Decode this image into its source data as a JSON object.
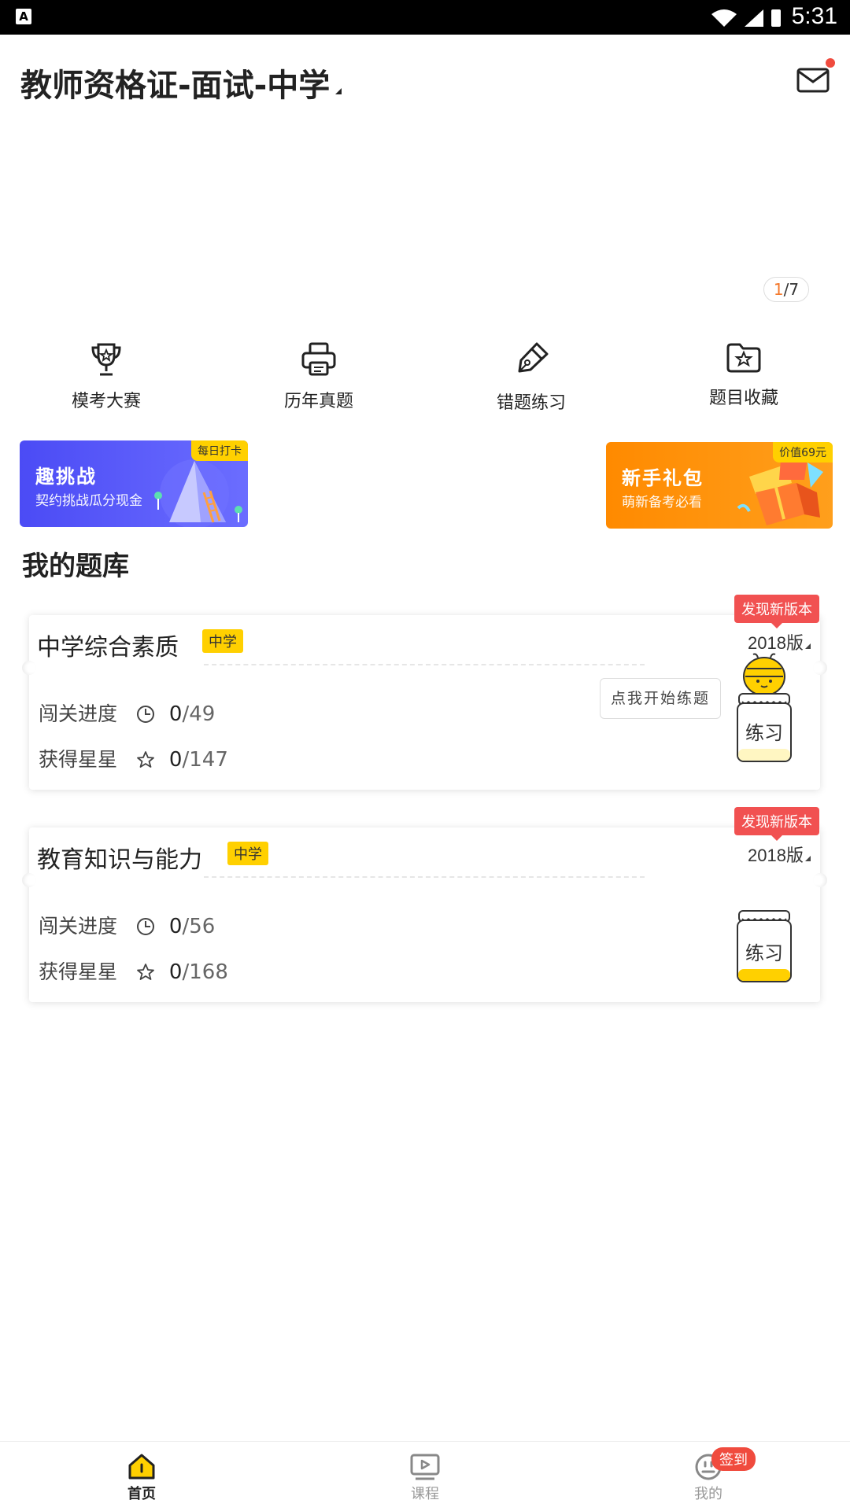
{
  "status_bar": {
    "time": "5:31",
    "left_icon": "A"
  },
  "header": {
    "title": "教师资格证-面试-中学",
    "mail_icon": "mail-icon",
    "has_notification": true
  },
  "carousel": {
    "current": "1",
    "total": "/7"
  },
  "quick_menu": [
    {
      "label": "模考大赛",
      "icon": "trophy-icon"
    },
    {
      "label": "历年真题",
      "icon": "printer-icon"
    },
    {
      "label": "错题练习",
      "icon": "pen-icon"
    },
    {
      "label": "题目收藏",
      "icon": "folder-star-icon"
    }
  ],
  "promos": [
    {
      "title": "趣挑战",
      "subtitle": "契约挑战瓜分现金",
      "tag": "每日打卡",
      "color": "#4b4bf5"
    },
    {
      "title": "新手礼包",
      "subtitle": "萌新备考必看",
      "tag": "价值69元",
      "color": "#ff8a00"
    }
  ],
  "bank": {
    "title": "我的题库",
    "tip": "点我开始练题",
    "items": [
      {
        "name": "中学综合素质",
        "level": "中学",
        "version": "2018版",
        "new_badge": "发现新版本",
        "progress_label": "闯关进度",
        "progress_done": "0",
        "progress_total": "/49",
        "stars_label": "获得星星",
        "stars_done": "0",
        "stars_total": "/147",
        "button": "练习"
      },
      {
        "name": "教育知识与能力",
        "level": "中学",
        "version": "2018版",
        "new_badge": "发现新版本",
        "progress_label": "闯关进度",
        "progress_done": "0",
        "progress_total": "/56",
        "stars_label": "获得星星",
        "stars_done": "0",
        "stars_total": "/168",
        "button": "练习"
      }
    ]
  },
  "bottom_nav": [
    {
      "label": "首页",
      "icon": "home-icon",
      "active": true
    },
    {
      "label": "课程",
      "icon": "play-icon",
      "active": false
    },
    {
      "label": "我的",
      "icon": "smile-icon",
      "active": false
    }
  ],
  "signin_badge": "签到",
  "colors": {
    "accent_yellow": "#ffd000",
    "badge_red": "#f15151",
    "notify_red": "#f04b3e"
  }
}
